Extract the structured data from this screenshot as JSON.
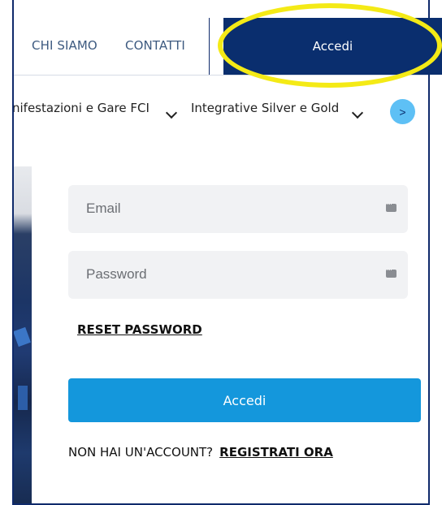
{
  "nav": {
    "chi_siamo": "CHI SIAMO",
    "contatti": "CONTATTI",
    "accedi": "Accedi"
  },
  "categories": {
    "items": [
      {
        "label": "nifestazioni e Gare FCI"
      },
      {
        "label": "Integrative Silver e Gold"
      }
    ],
    "next_label": ">"
  },
  "login": {
    "email_placeholder": "Email",
    "password_placeholder": "Password",
    "reset_password": "RESET PASSWORD",
    "submit": "Accedi",
    "no_account": "NON HAI UN'ACCOUNT?",
    "register": "REGISTRATI ORA"
  },
  "colors": {
    "nav_blue": "#0a2e6e",
    "button_blue": "#1497dc",
    "next_button": "#5ec0f5",
    "highlight": "#f4ea16",
    "field_bg": "#f1f2f4"
  },
  "icons": {
    "field_icon": "password-manager-key-icon",
    "chevron": "chevron-down-icon"
  }
}
